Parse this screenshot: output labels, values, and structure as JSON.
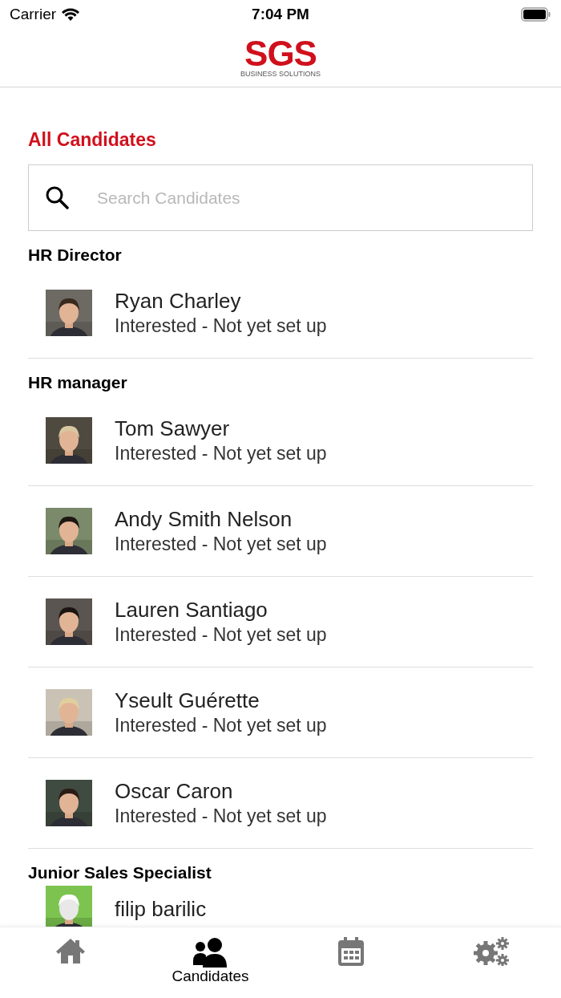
{
  "status_bar": {
    "carrier": "Carrier",
    "time": "7:04 PM"
  },
  "header": {
    "logo": "SGS",
    "logo_subtitle": "BUSINESS SOLUTIONS"
  },
  "title": "All Candidates",
  "search": {
    "placeholder": "Search Candidates"
  },
  "sections": [
    {
      "title": "HR Director",
      "candidates": [
        {
          "name": "Ryan Charley",
          "status": "Interested - Not yet set up"
        }
      ]
    },
    {
      "title": "HR manager",
      "candidates": [
        {
          "name": "Tom Sawyer",
          "status": "Interested - Not yet set up"
        },
        {
          "name": "Andy Smith Nelson",
          "status": "Interested - Not yet set up"
        },
        {
          "name": "Lauren Santiago",
          "status": "Interested - Not yet set up"
        },
        {
          "name": "Yseult Guérette",
          "status": "Interested - Not yet set up"
        },
        {
          "name": "Oscar Caron",
          "status": "Interested - Not yet set up"
        }
      ]
    },
    {
      "title": "Junior Sales Specialist",
      "candidates": [
        {
          "name": "filip barilic"
        }
      ]
    }
  ],
  "tabs": [
    {
      "kind": "home",
      "selected": false
    },
    {
      "kind": "candidates",
      "label": "Candidates",
      "selected": true
    },
    {
      "kind": "calendar",
      "selected": false
    },
    {
      "kind": "settings",
      "selected": false
    }
  ]
}
